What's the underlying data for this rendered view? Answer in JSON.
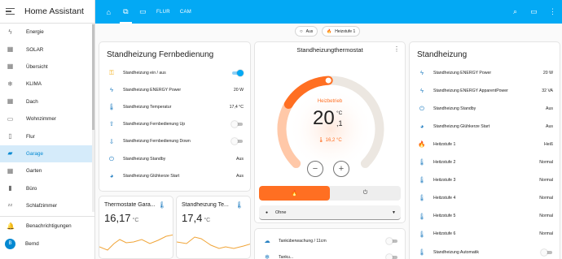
{
  "app_title": "Home Assistant",
  "sidebar": {
    "items": [
      {
        "label": "Energie",
        "icon": "lightning-icon",
        "glyph": "ϟ"
      },
      {
        "label": "SOLAR",
        "icon": "dashboard-icon",
        "glyph": "▦"
      },
      {
        "label": "Übersicht",
        "icon": "dashboard-icon",
        "glyph": "▦"
      },
      {
        "label": "KLIMA",
        "icon": "air-conditioner-icon",
        "glyph": "❄"
      },
      {
        "label": "Dach",
        "icon": "dashboard-icon",
        "glyph": "▦"
      },
      {
        "label": "Wohnzimmer",
        "icon": "sofa-icon",
        "glyph": "▭"
      },
      {
        "label": "Flur",
        "icon": "door-icon",
        "glyph": "▯"
      },
      {
        "label": "Garage",
        "icon": "car-icon",
        "glyph": "▰"
      },
      {
        "label": "Garten",
        "icon": "dashboard-icon",
        "glyph": "▦"
      },
      {
        "label": "Büro",
        "icon": "book-icon",
        "glyph": "▮"
      },
      {
        "label": "Schlafzimmer",
        "icon": "sleep-icon",
        "glyph": "ᶻᶻ"
      }
    ],
    "active_index": 7,
    "notifications_label": "Benachrichtigungen",
    "user_name": "Bernd",
    "user_initial": "B"
  },
  "topbar": {
    "tabs": [
      {
        "type": "icon",
        "icon": "home-icon",
        "glyph": "⌂"
      },
      {
        "type": "icon",
        "icon": "devices-icon",
        "glyph": "⧉"
      },
      {
        "type": "icon",
        "icon": "battery-icon",
        "glyph": "▭"
      },
      {
        "type": "text",
        "label": "FLUR"
      },
      {
        "type": "text",
        "label": "CAM"
      }
    ],
    "selected_tab": 1
  },
  "chips": [
    {
      "label": "Aus",
      "icon": "power-off-icon",
      "glyph": "○"
    },
    {
      "label": "Heizstufe 1",
      "icon": "fire-icon",
      "glyph": "🔥"
    }
  ],
  "remote_card": {
    "title": "Standheizung Fernbedienung",
    "rows": [
      {
        "name": "Standheizung ein / aus",
        "icon": "car-key-icon",
        "glyph": "⚿",
        "color": "amber",
        "toggle": true,
        "on": true
      },
      {
        "name": "Standheizung ENERGY Power",
        "icon": "lightning-icon",
        "glyph": "ϟ",
        "color": "blue",
        "value": "20 W"
      },
      {
        "name": "Standheizung Temperatur",
        "icon": "thermometer-icon",
        "glyph": "🌡",
        "color": "blue",
        "value": "17,4 °C"
      },
      {
        "name": "Standheizung Fernbedienung Up",
        "icon": "arrow-up-icon",
        "glyph": "⇧",
        "color": "blue",
        "toggle": true,
        "on": false
      },
      {
        "name": "Standheizung Fernbedienung Down",
        "icon": "arrow-down-icon",
        "glyph": "⇩",
        "color": "blue",
        "toggle": true,
        "on": false
      },
      {
        "name": "Standheizung Standby",
        "icon": "power-icon",
        "glyph": "⏻",
        "color": "blue",
        "value": "Aus"
      },
      {
        "name": "Standheizung Glühkerze Start",
        "icon": "gauge-icon",
        "glyph": "◕",
        "color": "blue",
        "value": "Aus"
      }
    ]
  },
  "sensors": [
    {
      "name": "Thermostate Gara...",
      "value": "16,17",
      "unit": "°C",
      "icon": "thermometer-icon"
    },
    {
      "name": "Standheizung Te...",
      "value": "17,4",
      "unit": "°C",
      "icon": "thermometer-icon"
    }
  ],
  "thermostat": {
    "title": "Standheizungthermostat",
    "mode_label": "Heizbetrieb",
    "target_int": "20",
    "target_dec": ",1",
    "unit": "°C",
    "current": "16,2 °C",
    "level": 0.49,
    "preset": "Ohne",
    "accent": "#ff6f22"
  },
  "thermo_extra": [
    {
      "name": "Tanküberwachung / 11cm",
      "icon": "tank-icon",
      "glyph": "☁"
    },
    {
      "name": "Tanku...",
      "icon": "snowflake-icon",
      "glyph": "❄"
    }
  ],
  "status_card": {
    "title": "Standheizung",
    "rows": [
      {
        "name": "Standheizung ENERGY Power",
        "icon": "lightning-icon",
        "glyph": "ϟ",
        "color": "blue",
        "value": "20 W"
      },
      {
        "name": "Standheizung ENERGY ApparentPower",
        "icon": "lightning-icon",
        "glyph": "ϟ",
        "color": "blue",
        "value": "32 VA"
      },
      {
        "name": "Standheizung Standby",
        "icon": "power-icon",
        "glyph": "⏻",
        "color": "blue",
        "value": "Aus"
      },
      {
        "name": "Standheizung Glühkerze Start",
        "icon": "gauge-icon",
        "glyph": "◕",
        "color": "blue",
        "value": "Aus"
      },
      {
        "name": "Heitzstufe 1",
        "icon": "fire-icon",
        "glyph": "🔥",
        "color": "red",
        "value": "Heiß"
      },
      {
        "name": "Heitzstufe 2",
        "icon": "thermometer-icon",
        "glyph": "🌡",
        "color": "blue",
        "value": "Normal"
      },
      {
        "name": "Heitzstufe 3",
        "icon": "thermometer-icon",
        "glyph": "🌡",
        "color": "blue",
        "value": "Normal"
      },
      {
        "name": "Heitzstufe 4",
        "icon": "thermometer-icon",
        "glyph": "🌡",
        "color": "blue",
        "value": "Normal"
      },
      {
        "name": "Heitzstufe 5",
        "icon": "thermometer-icon",
        "glyph": "🌡",
        "color": "blue",
        "value": "Normal"
      },
      {
        "name": "Heitzstufe 6",
        "icon": "thermometer-icon",
        "glyph": "🌡",
        "color": "blue",
        "value": "Normal"
      },
      {
        "name": "Standheizung Automatik",
        "icon": "thermometer-icon",
        "glyph": "🌡",
        "color": "blue",
        "toggle": true,
        "on": false
      }
    ]
  }
}
